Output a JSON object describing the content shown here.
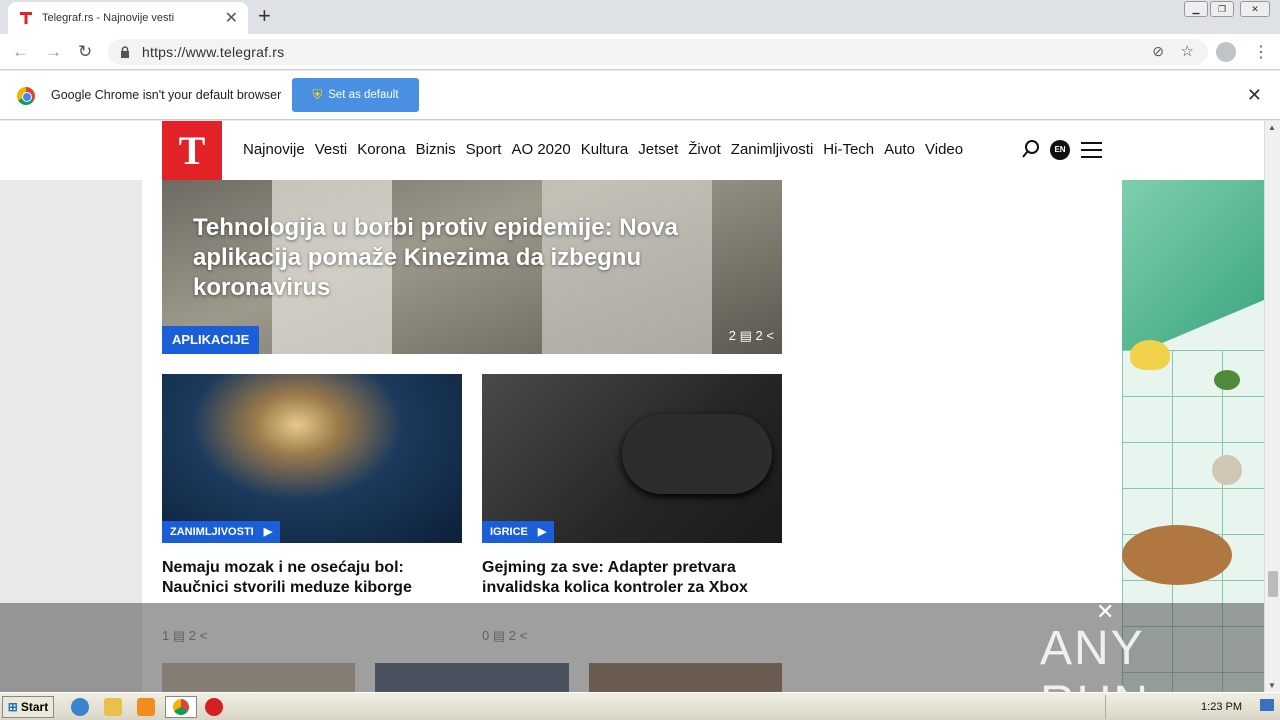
{
  "browser": {
    "tab_title": "Telegraf.rs - Najnovije vesti",
    "url": "https://www.telegraf.rs",
    "infobar_text": "Google Chrome isn't your default browser",
    "set_default_label": "Set as default"
  },
  "site": {
    "logo_text": "T",
    "nav": [
      "Najnovije",
      "Vesti",
      "Korona",
      "Biznis",
      "Sport",
      "AO 2020",
      "Kultura",
      "Jetset",
      "Život",
      "Zanimljivosti",
      "Hi-Tech",
      "Auto",
      "Video"
    ],
    "lang": "EN"
  },
  "hero": {
    "title": "Tehnologija u borbi protiv epidemije: Nova aplikacija pomaže Kinezima da izbegnu koronavirus",
    "category": "APLIKACIJE",
    "comments": "2",
    "shares": "2"
  },
  "cards": [
    {
      "category": "ZANIMLJIVOSTI",
      "title": "Nemaju mozak i ne osećaju bol: Naučnici stvorili meduze kiborge",
      "comments": "1",
      "shares": "2"
    },
    {
      "category": "IGRICE",
      "title": "Gejming za sve: Adapter pretvara invalidska kolica kontroler za Xbox",
      "comments": "0",
      "shares": "2"
    }
  ],
  "watermark": "ANY RUN",
  "taskbar": {
    "start_label": "Start",
    "clock": "1:23 PM"
  }
}
